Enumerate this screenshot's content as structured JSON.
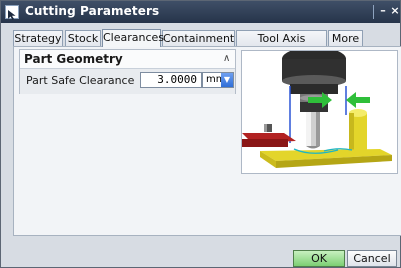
{
  "window": {
    "title": "Cutting Parameters",
    "min_label": "–",
    "close_label": "×"
  },
  "tabs": [
    {
      "label": "Strategy",
      "active": false
    },
    {
      "label": "Stock",
      "active": false
    },
    {
      "label": "Clearances",
      "active": true
    },
    {
      "label": "Containment",
      "active": false
    },
    {
      "label": "Tool Axis Control",
      "active": false
    },
    {
      "label": "More",
      "active": false
    }
  ],
  "group": {
    "title": "Part Geometry",
    "collapse_glyph": "∧",
    "field_label": "Part Safe Clearance",
    "value": "3.0000",
    "unit": "mm",
    "unit_arrow": "▼"
  },
  "buttons": {
    "ok": "OK",
    "cancel": "Cancel"
  },
  "colors": {
    "title_bg": "#2f3d55",
    "ok_bg": "#8ad480",
    "tool_body": "#2a2a2a",
    "part_yellow": "#e3d52a",
    "arrow_green": "#2fbf3a"
  },
  "icons": {
    "window_icon": "cursor-icon",
    "collapse": "chevron-up-icon",
    "dropdown": "dropdown-arrow-icon"
  }
}
